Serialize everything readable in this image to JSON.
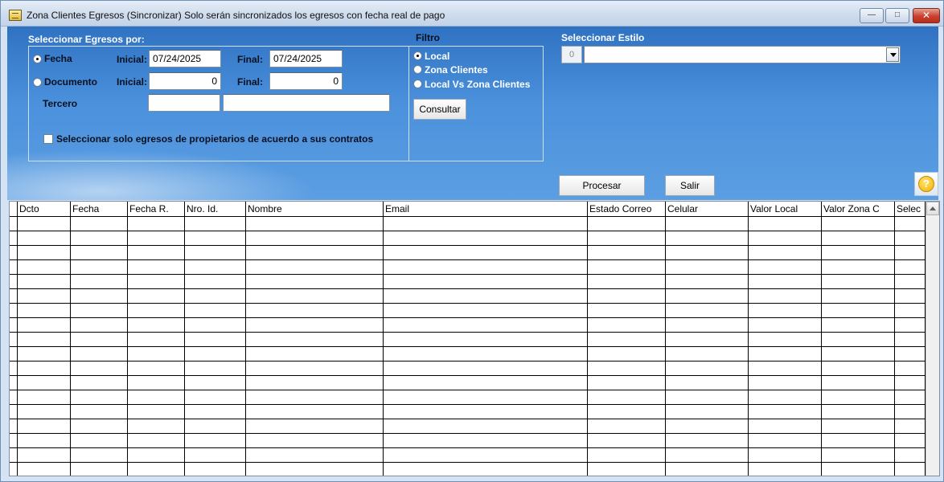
{
  "window": {
    "title": "Zona Clientes Egresos (Sincronizar) Solo serán sincronizados los egresos con fecha real de pago"
  },
  "select_by": {
    "heading": "Seleccionar Egresos por:",
    "fecha": {
      "label": "Fecha",
      "checked": true,
      "inicial_label": "Inicial:",
      "inicial_value": "07/24/2025",
      "final_label": "Final:",
      "final_value": "07/24/2025"
    },
    "documento": {
      "label": "Documento",
      "checked": false,
      "inicial_label": "Inicial:",
      "inicial_value": "0",
      "final_label": "Final:",
      "final_value": "0"
    },
    "tercero": {
      "label": "Tercero",
      "code_value": "",
      "name_value": ""
    },
    "owners_checkbox_label": "Seleccionar solo egresos de propietarios de acuerdo a sus contratos"
  },
  "filter": {
    "heading": "Filtro",
    "options": [
      {
        "label": "Local",
        "checked": true
      },
      {
        "label": "Zona Clientes",
        "checked": false
      },
      {
        "label": "Local Vs Zona Clientes",
        "checked": false
      }
    ],
    "consultar_label": "Consultar"
  },
  "style": {
    "heading": "Seleccionar Estilo",
    "number": "0",
    "selected_value": ""
  },
  "actions": {
    "procesar_label": "Procesar",
    "salir_label": "Salir",
    "help_symbol": "?"
  },
  "grid": {
    "columns": [
      "Dcto",
      "Fecha",
      "Fecha R.",
      "Nro. Id.",
      "Nombre",
      "Email",
      "Estado Correo",
      "Celular",
      "Valor Local",
      "Valor Zona C",
      "Selec"
    ],
    "row_count": 18
  }
}
